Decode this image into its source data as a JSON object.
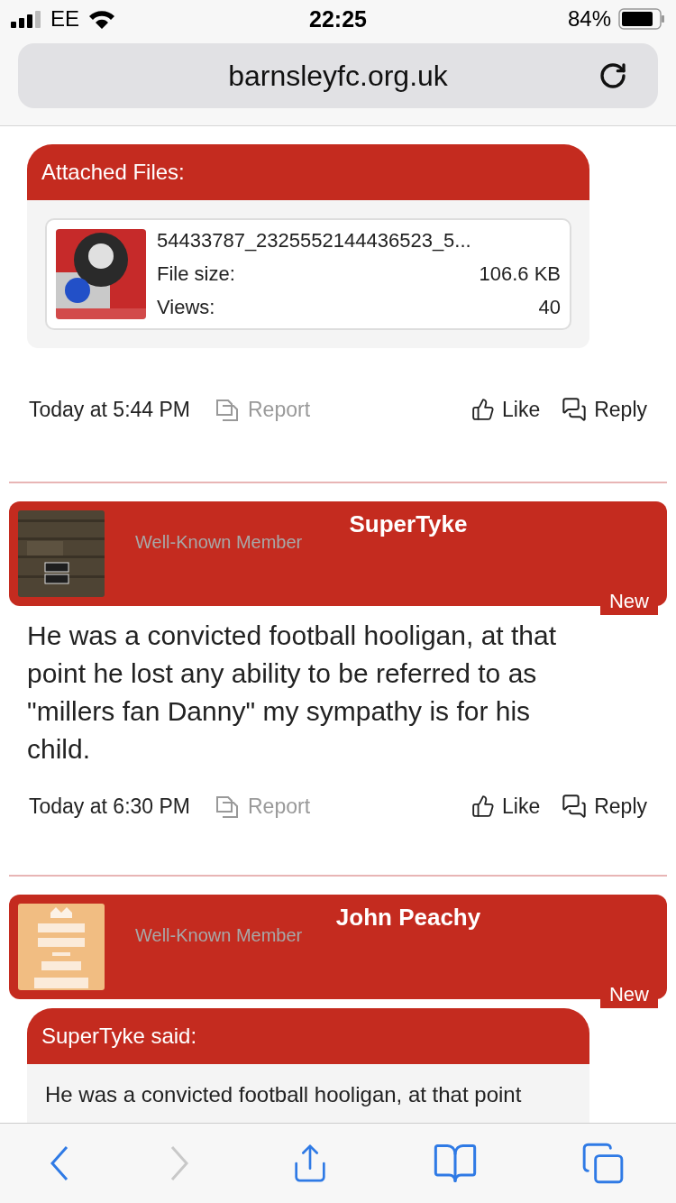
{
  "status_bar": {
    "carrier": "EE",
    "time": "22:25",
    "battery": "84%"
  },
  "address_bar": {
    "url": "barnsleyfc.org.uk"
  },
  "posts": [
    {
      "kind": "attachments",
      "title": "Attached Files:",
      "files": [
        {
          "name": "54433787_2325552144436523_5...",
          "size_label": "File size:",
          "size": "106.6 KB",
          "views_label": "Views:",
          "views": "40"
        }
      ],
      "time": "Today at 5:44 PM",
      "actions": {
        "report": "Report",
        "like": "Like",
        "reply": "Reply"
      }
    },
    {
      "kind": "message",
      "author": "SuperTyke",
      "role": "Well-Known Member",
      "badge": "New",
      "message": "He was a convicted football hooligan, at that point he lost any ability to be referred to as \"millers fan Danny\" my sympathy is for his child.",
      "time": "Today at 6:30 PM",
      "actions": {
        "report": "Report",
        "like": "Like",
        "reply": "Reply"
      }
    },
    {
      "kind": "quote",
      "author": "John Peachy",
      "role": "Well-Known Member",
      "badge": "New",
      "quote": {
        "source": "SuperTyke said:",
        "text": "He was a convicted football hooligan, at that point"
      }
    }
  ],
  "toolbar": {
    "back": {
      "disabled": false
    },
    "forward": {
      "disabled": true
    }
  }
}
